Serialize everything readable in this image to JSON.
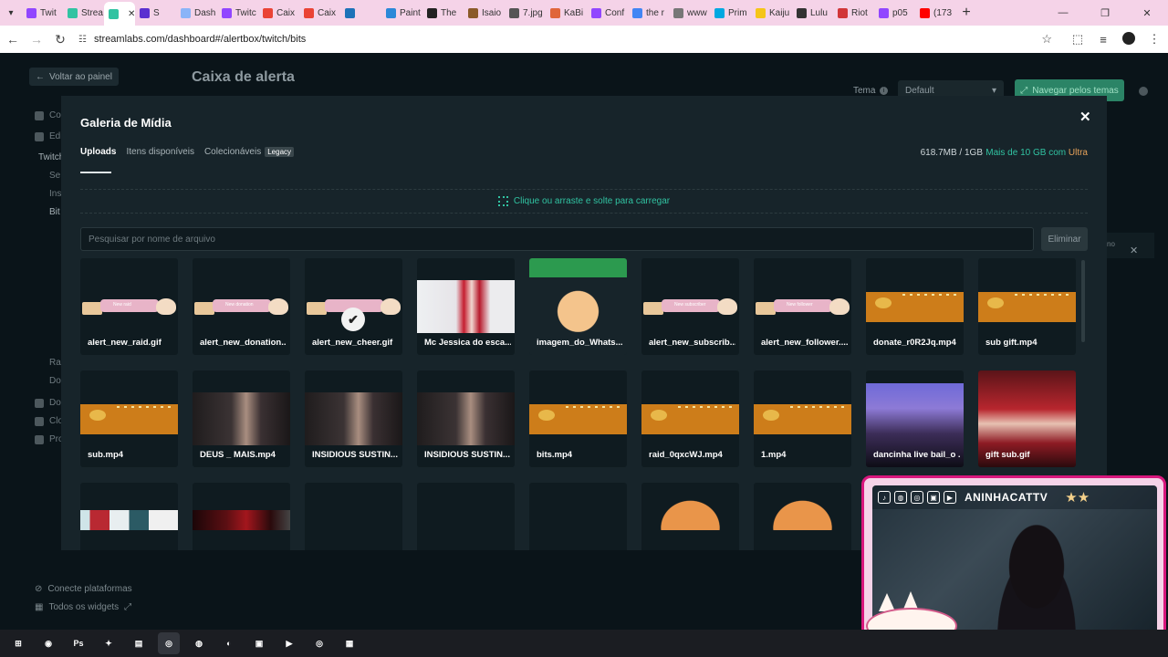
{
  "browser": {
    "tabs": [
      {
        "label": "Twit",
        "color": "#9146ff"
      },
      {
        "label": "Strea",
        "color": "#31c3a2"
      },
      {
        "label": "",
        "color": "#31c3a2",
        "active": true
      },
      {
        "label": "S",
        "color": "#5a2fd0"
      },
      {
        "label": "Dash",
        "color": "#8ab4f8"
      },
      {
        "label": "Twitc",
        "color": "#9146ff"
      },
      {
        "label": "Caix",
        "color": "#ea4335"
      },
      {
        "label": "Caix",
        "color": "#ea4335"
      },
      {
        "label": "",
        "color": "#1d72b8"
      },
      {
        "label": "Paint",
        "color": "#2b88d8"
      },
      {
        "label": "The",
        "color": "#222222"
      },
      {
        "label": "Isaio",
        "color": "#8a5a2a"
      },
      {
        "label": "7.jpg",
        "color": "#555555"
      },
      {
        "label": "KaBi",
        "color": "#e0653a"
      },
      {
        "label": "Conf",
        "color": "#9146ff"
      },
      {
        "label": "the r",
        "color": "#4285f4"
      },
      {
        "label": "www",
        "color": "#777777"
      },
      {
        "label": "Prim",
        "color": "#00a8e1"
      },
      {
        "label": "Kaiju",
        "color": "#f5c518"
      },
      {
        "label": "Lulu",
        "color": "#333333"
      },
      {
        "label": "Riot",
        "color": "#d13639"
      },
      {
        "label": "p05",
        "color": "#9146ff"
      },
      {
        "label": "(173",
        "color": "#ff0000"
      }
    ],
    "url": "streamlabs.com/dashboard#/alertbox/twitch/bits"
  },
  "page": {
    "back_label": "Voltar ao painel",
    "title": "Caixa de alerta",
    "theme_label": "Tema",
    "theme_value": "Default",
    "themes_button": "Navegar pelos temas",
    "sidebar": [
      {
        "label": "Co",
        "bright": false
      },
      {
        "label": "Edi",
        "bright": false
      },
      {
        "label": "Twitch",
        "bright": true
      },
      {
        "label": "Se",
        "bright": false
      },
      {
        "label": "Ins",
        "bright": false
      },
      {
        "label": "Bit",
        "bright": true
      },
      {
        "label": "Ra",
        "bright": false
      },
      {
        "label": "Do",
        "bright": false
      },
      {
        "label": "Do",
        "bright": false
      },
      {
        "label": "Clo",
        "bright": false
      },
      {
        "label": "Pro",
        "bright": false
      }
    ],
    "bottom_links": [
      "Conecte plataformas",
      "Todos os widgets"
    ],
    "right_panel_text": "no"
  },
  "modal": {
    "title": "Galeria de Mídia",
    "tabs": [
      {
        "label": "Uploads",
        "active": true
      },
      {
        "label": "Itens disponíveis",
        "active": false
      },
      {
        "label": "Colecionáveis",
        "active": false,
        "badge": "Legacy"
      }
    ],
    "storage": "618.7MB / 1GB",
    "upgrade_prefix": "Mais de 10 GB com ",
    "upgrade_brand": "Ultra",
    "dropzone": "Clique ou arraste e solte para carregar",
    "search_placeholder": "Pesquisar por nome de arquivo",
    "delete_label": "Eliminar",
    "items": [
      {
        "name": "alert_new_raid.gif",
        "thumb": "banner",
        "banner_text": "New raid"
      },
      {
        "name": "alert_new_donation....",
        "thumb": "banner",
        "banner_text": "New donation"
      },
      {
        "name": "alert_new_cheer.gif",
        "thumb": "banner",
        "banner_text": "",
        "selected": true
      },
      {
        "name": "Mc Jessica do esca...",
        "thumb": "photo-xmas"
      },
      {
        "name": "imagem_do_Whats...",
        "thumb": "gift"
      },
      {
        "name": "alert_new_subscrib...",
        "thumb": "banner",
        "banner_text": "New subscriber"
      },
      {
        "name": "alert_new_follower....",
        "thumb": "banner",
        "banner_text": "New follower"
      },
      {
        "name": "donate_r0R2Jq.mp4",
        "thumb": "orange"
      },
      {
        "name": "sub gift.mp4",
        "thumb": "orange"
      },
      {
        "name": "sub.mp4",
        "thumb": "orange"
      },
      {
        "name": "DEUS _ MAIS.mp4",
        "thumb": "photo-dark"
      },
      {
        "name": "INSIDIOUS SUSTIN...",
        "thumb": "photo-dark"
      },
      {
        "name": "INSIDIOUS SUSTIN...",
        "thumb": "photo-dark"
      },
      {
        "name": "bits.mp4",
        "thumb": "orange"
      },
      {
        "name": "raid_0qxcWJ.mp4",
        "thumb": "orange"
      },
      {
        "name": "1.mp4",
        "thumb": "orange"
      },
      {
        "name": "dancinha live bail_o ...",
        "thumb": "catgirl"
      },
      {
        "name": "gift sub.gif",
        "thumb": "giftgif"
      },
      {
        "name": "",
        "thumb": "pokes"
      },
      {
        "name": "",
        "thumb": "redbanner"
      },
      {
        "name": "",
        "thumb": "empty"
      },
      {
        "name": "",
        "thumb": "empty"
      },
      {
        "name": "",
        "thumb": "empty"
      },
      {
        "name": "",
        "thumb": "catpeek"
      },
      {
        "name": "",
        "thumb": "catpeek"
      }
    ]
  },
  "webcam": {
    "channel": "ANINHACATTV",
    "socials": [
      "tiktok-icon",
      "discord-icon",
      "instagram-icon",
      "twitch-icon",
      "youtube-icon"
    ]
  },
  "taskbar": {
    "apps": [
      {
        "name": "start-icon",
        "label": "⊞"
      },
      {
        "name": "obs-icon",
        "label": "◉"
      },
      {
        "name": "photoshop-icon",
        "label": "Ps"
      },
      {
        "name": "copilot-icon",
        "label": "✦"
      },
      {
        "name": "file-explorer-icon",
        "label": "▤"
      },
      {
        "name": "chrome-icon",
        "label": "◎",
        "active": true
      },
      {
        "name": "discord-icon",
        "label": "◍"
      },
      {
        "name": "streamlabs-icon",
        "label": "◐"
      },
      {
        "name": "app-icon",
        "label": "▣"
      },
      {
        "name": "player-icon",
        "label": "▶"
      },
      {
        "name": "spotify-icon",
        "label": "◎"
      },
      {
        "name": "capcut-icon",
        "label": "▦"
      }
    ]
  },
  "colors": {
    "accent": "#31c3a2",
    "ultra": "#e7a25a",
    "cam_border": "#d8177d"
  }
}
